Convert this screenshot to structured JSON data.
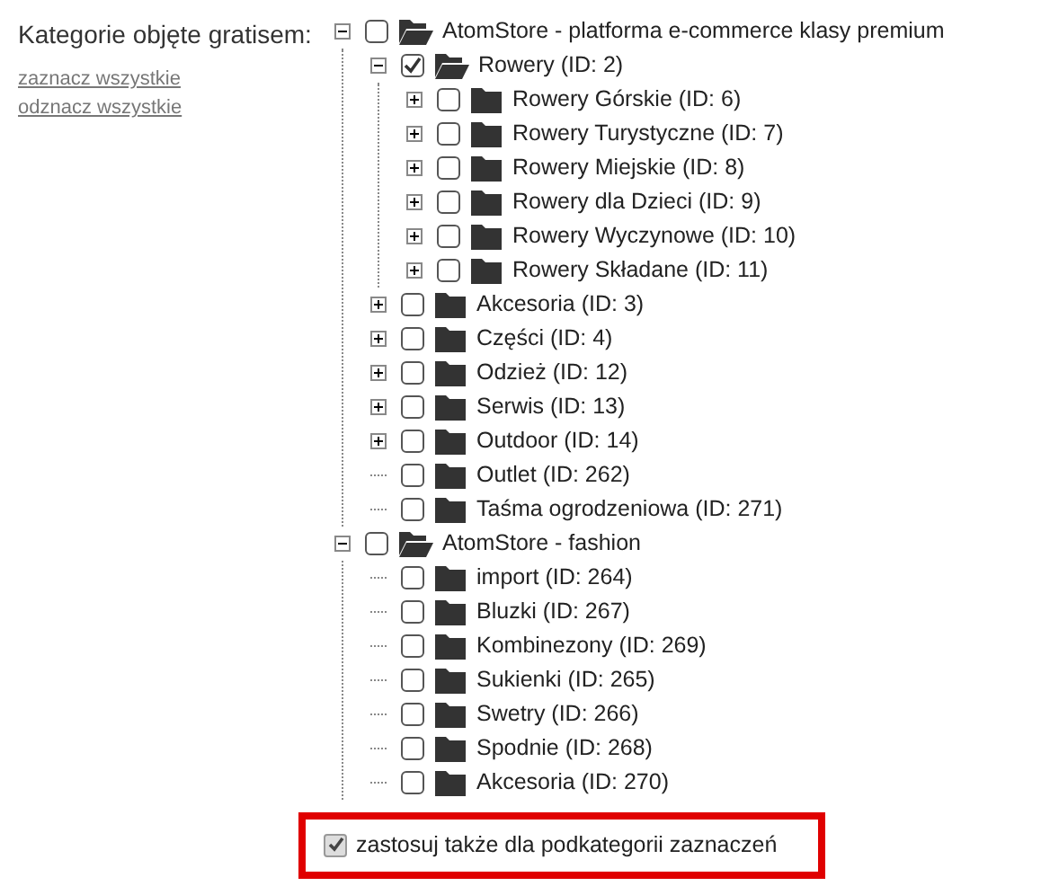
{
  "label": "Kategorie objęte gratisem:",
  "links": [
    "zaznacz wszystkie",
    "odznacz wszystkie"
  ],
  "tree": [
    {
      "label": "AtomStore - platforma e-commerce klasy premium",
      "kind": "expanded",
      "checked": false,
      "children": [
        {
          "label": "Rowery (ID: 2)",
          "kind": "expanded",
          "checked": true,
          "children": [
            {
              "label": "Rowery Górskie (ID: 6)",
              "kind": "collapsed",
              "checked": false
            },
            {
              "label": "Rowery Turystyczne (ID: 7)",
              "kind": "collapsed",
              "checked": false
            },
            {
              "label": "Rowery Miejskie (ID: 8)",
              "kind": "collapsed",
              "checked": false
            },
            {
              "label": "Rowery dla Dzieci (ID: 9)",
              "kind": "collapsed",
              "checked": false
            },
            {
              "label": "Rowery Wyczynowe (ID: 10)",
              "kind": "collapsed",
              "checked": false
            },
            {
              "label": "Rowery Składane (ID: 11)",
              "kind": "collapsed",
              "checked": false
            }
          ]
        },
        {
          "label": "Akcesoria (ID: 3)",
          "kind": "collapsed",
          "checked": false
        },
        {
          "label": "Części (ID: 4)",
          "kind": "collapsed",
          "checked": false
        },
        {
          "label": "Odzież (ID: 12)",
          "kind": "collapsed",
          "checked": false
        },
        {
          "label": "Serwis (ID: 13)",
          "kind": "collapsed",
          "checked": false
        },
        {
          "label": "Outdoor (ID: 14)",
          "kind": "collapsed",
          "checked": false
        },
        {
          "label": "Outlet (ID: 262)",
          "kind": "leaf",
          "checked": false
        },
        {
          "label": "Taśma ogrodzeniowa (ID: 271)",
          "kind": "leaf",
          "checked": false
        }
      ]
    },
    {
      "label": "AtomStore - fashion",
      "kind": "expanded",
      "checked": false,
      "children": [
        {
          "label": "import (ID: 264)",
          "kind": "leaf",
          "checked": false
        },
        {
          "label": "Bluzki (ID: 267)",
          "kind": "leaf",
          "checked": false
        },
        {
          "label": "Kombinezony (ID: 269)",
          "kind": "leaf",
          "checked": false
        },
        {
          "label": "Sukienki (ID: 265)",
          "kind": "leaf",
          "checked": false
        },
        {
          "label": "Swetry (ID: 266)",
          "kind": "leaf",
          "checked": false
        },
        {
          "label": "Spodnie (ID: 268)",
          "kind": "leaf",
          "checked": false
        },
        {
          "label": "Akcesoria (ID: 270)",
          "kind": "leaf",
          "checked": false
        }
      ]
    }
  ],
  "apply_subcategories": {
    "label": "zastosuj także dla podkategorii zaznaczeń",
    "checked": true
  }
}
